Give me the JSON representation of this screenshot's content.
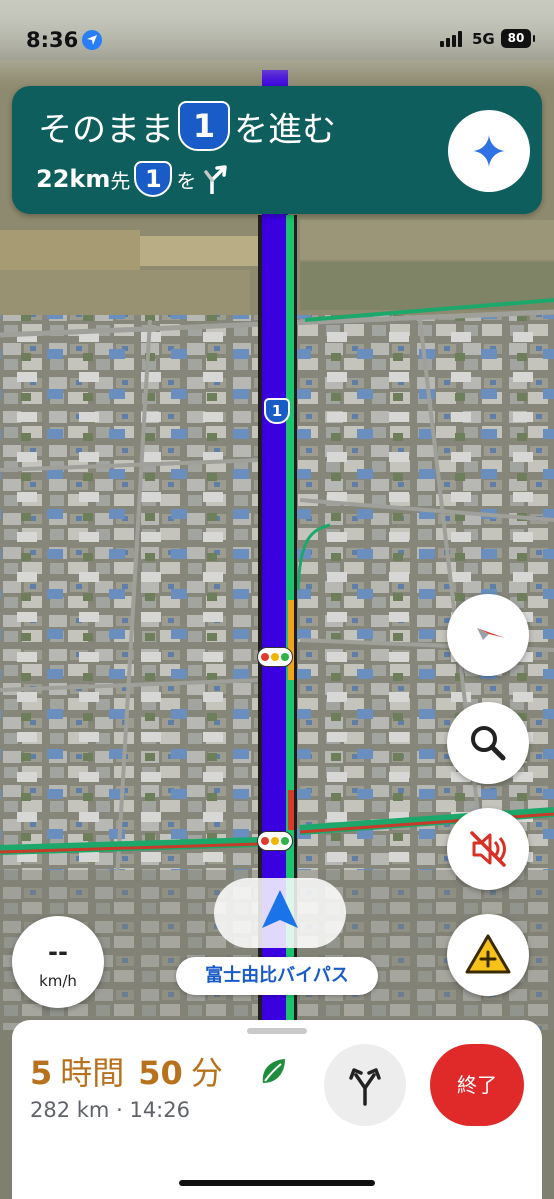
{
  "status_bar": {
    "time": "8:36",
    "network": "5G",
    "battery": "80"
  },
  "instruction": {
    "prefix": "そのまま",
    "route_number": "1",
    "suffix": "を進む",
    "next_distance": "22km",
    "next_distance_unit": "先",
    "next_route_number": "1",
    "next_after": "を",
    "next_turn_icon": "fork-right-icon",
    "assistant_icon": "gemini-sparkle-icon"
  },
  "map": {
    "route_shield": "1",
    "route_color": "#3a00e0",
    "traffic_light_icon": "traffic-light-icon"
  },
  "controls": {
    "compass_icon": "compass-icon",
    "search_icon": "search-icon",
    "mute_icon": "sound-off-icon",
    "report_icon": "report-incident-icon"
  },
  "speed": {
    "value": "--",
    "unit": "km/h"
  },
  "current_road": "富士由比バイパス",
  "trip": {
    "hours": "5",
    "hours_label": "時間",
    "minutes": "50",
    "minutes_label": "分",
    "eco_icon": "leaf-icon",
    "distance": "282 km",
    "separator": "·",
    "arrival": "14:26",
    "alt_routes_icon": "alternate-routes-icon",
    "end_label": "終了"
  },
  "colors": {
    "banner": "#0d5e5c",
    "eta": "#b8721d",
    "end_button": "#e02a2a",
    "accent_blue": "#1a5cc7"
  }
}
